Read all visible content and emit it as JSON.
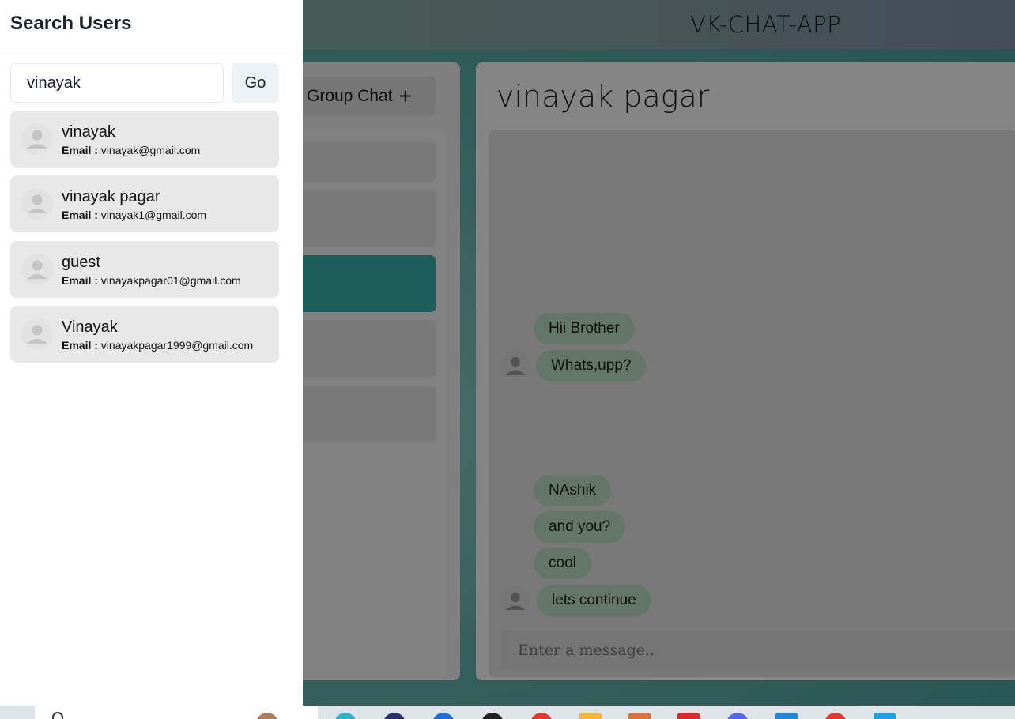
{
  "app": {
    "title": "VK-CHAT-APP"
  },
  "chats": {
    "group_chat_label": "Group Chat",
    "group_chat_icon": "plus-icon"
  },
  "conversation": {
    "title": "vinayak pagar",
    "messages": [
      "Hii Brother",
      "Whats,upp?",
      "NAshik",
      "and you?",
      "cool",
      "lets continue"
    ],
    "input_placeholder": "Enter a message.."
  },
  "drawer": {
    "title": "Search Users",
    "search_value": "vinayak",
    "go_label": "Go",
    "email_label": "Email :",
    "results": [
      {
        "name": "vinayak",
        "email": "vinayak@gmail.com"
      },
      {
        "name": "vinayak pagar",
        "email": "vinayak1@gmail.com"
      },
      {
        "name": "guest",
        "email": "vinayakpagar01@gmail.com"
      },
      {
        "name": "Vinayak",
        "email": "vinayakpagar1999@gmail.com"
      }
    ]
  },
  "colors": {
    "accent": "#38b2ac",
    "bubble": "#bee3c6",
    "card": "#e8e8e8"
  }
}
